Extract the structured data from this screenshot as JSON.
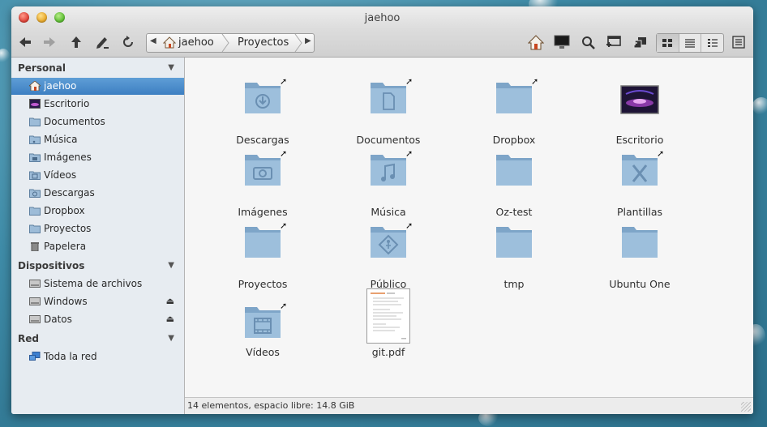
{
  "window": {
    "title": "jaehoo"
  },
  "toolbar": {
    "back_icon": "arrow-left-icon",
    "forward_icon": "arrow-right-icon",
    "up_icon": "arrow-up-icon",
    "edit_icon": "pencil-icon",
    "reload_icon": "reload-icon"
  },
  "breadcrumb": {
    "home_label": "jaehoo",
    "current_label": "Proyectos"
  },
  "sidebar": {
    "personal_header": "Personal",
    "personal_items": [
      {
        "label": "jaehoo",
        "icon": "home-icon"
      },
      {
        "label": "Escritorio",
        "icon": "desktop-icon"
      },
      {
        "label": "Documentos",
        "icon": "folder-icon"
      },
      {
        "label": "Música",
        "icon": "folder-music-icon"
      },
      {
        "label": "Imágenes",
        "icon": "folder-pictures-icon"
      },
      {
        "label": "Vídeos",
        "icon": "folder-videos-icon"
      },
      {
        "label": "Descargas",
        "icon": "folder-download-icon"
      },
      {
        "label": "Dropbox",
        "icon": "folder-icon"
      },
      {
        "label": "Proyectos",
        "icon": "folder-icon"
      },
      {
        "label": "Papelera",
        "icon": "trash-icon"
      }
    ],
    "devices_header": "Dispositivos",
    "device_items": [
      {
        "label": "Sistema de archivos",
        "icon": "drive-icon"
      },
      {
        "label": "Windows",
        "icon": "drive-icon"
      },
      {
        "label": "Datos",
        "icon": "drive-icon"
      }
    ],
    "network_header": "Red",
    "network_items": [
      {
        "label": "Toda la red",
        "icon": "network-icon"
      }
    ]
  },
  "files": [
    {
      "name": "Descargas",
      "icon": "folder-download-icon",
      "link": true
    },
    {
      "name": "Documentos",
      "icon": "folder-documents-icon",
      "link": true
    },
    {
      "name": "Dropbox",
      "icon": "folder-icon",
      "link": true
    },
    {
      "name": "Escritorio",
      "icon": "desktop-icon",
      "link": false
    },
    {
      "name": "Imágenes",
      "icon": "folder-pictures-icon",
      "link": true
    },
    {
      "name": "Música",
      "icon": "folder-music-icon",
      "link": true
    },
    {
      "name": "Oz-test",
      "icon": "folder-icon",
      "link": false
    },
    {
      "name": "Plantillas",
      "icon": "folder-templates-icon",
      "link": true
    },
    {
      "name": "Proyectos",
      "icon": "folder-icon",
      "link": true
    },
    {
      "name": "Público",
      "icon": "folder-public-icon",
      "link": true
    },
    {
      "name": "tmp",
      "icon": "folder-icon",
      "link": false
    },
    {
      "name": "Ubuntu One",
      "icon": "folder-icon",
      "link": false
    },
    {
      "name": "Vídeos",
      "icon": "folder-videos-icon",
      "link": true
    },
    {
      "name": "git.pdf",
      "icon": "pdf-document-icon",
      "link": false
    }
  ],
  "status": {
    "text": "14 elementos, espacio libre: 14.8 GiB"
  },
  "colors": {
    "selection": "#4a8ccb",
    "folder": "#8fb3d4",
    "sidebar_bg": "#e7ecf1"
  }
}
